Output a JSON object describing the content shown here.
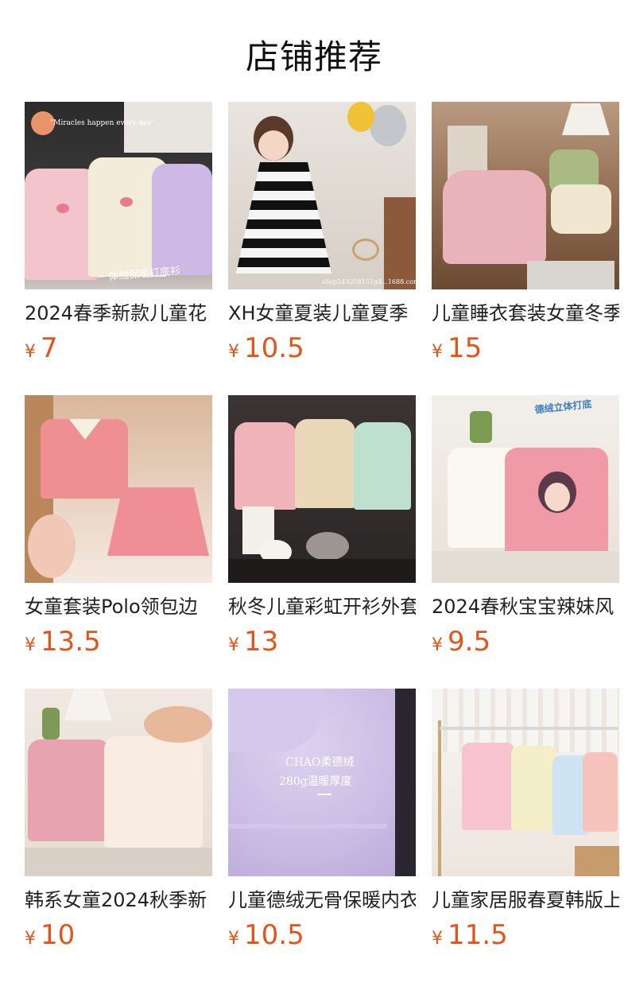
{
  "header": {
    "title": "店铺推荐"
  },
  "currency_symbol": "¥",
  "products": [
    {
      "name": "2024春季新款儿童花",
      "price": "7",
      "image_caption": "\"Miracles happen every day\"",
      "image_badge": "一体绒保暖打底衫"
    },
    {
      "name": "XH女童夏装儿童夏季",
      "price": "10.5",
      "image_caption": "shop243258151g4...1688.com"
    },
    {
      "name": "儿童睡衣套装女童冬季",
      "price": "15"
    },
    {
      "name": "女童套装Polo领包边",
      "price": "13.5"
    },
    {
      "name": "秋冬儿童彩虹开衫外套",
      "price": "13"
    },
    {
      "name": "2024春秋宝宝辣妹风",
      "price": "9.5",
      "image_badge": "德绒立体打底"
    },
    {
      "name": "韩系女童2024秋季新",
      "price": "10"
    },
    {
      "name": "儿童德绒无骨保暖内衣",
      "price": "10.5",
      "image_caption": "CHAO柔德绒",
      "image_badge": "280g温暖厚度"
    },
    {
      "name": "儿童家居服春夏韩版上",
      "price": "11.5"
    }
  ],
  "colors": {
    "price": "#e45418",
    "title": "#111111",
    "text": "#222222"
  }
}
